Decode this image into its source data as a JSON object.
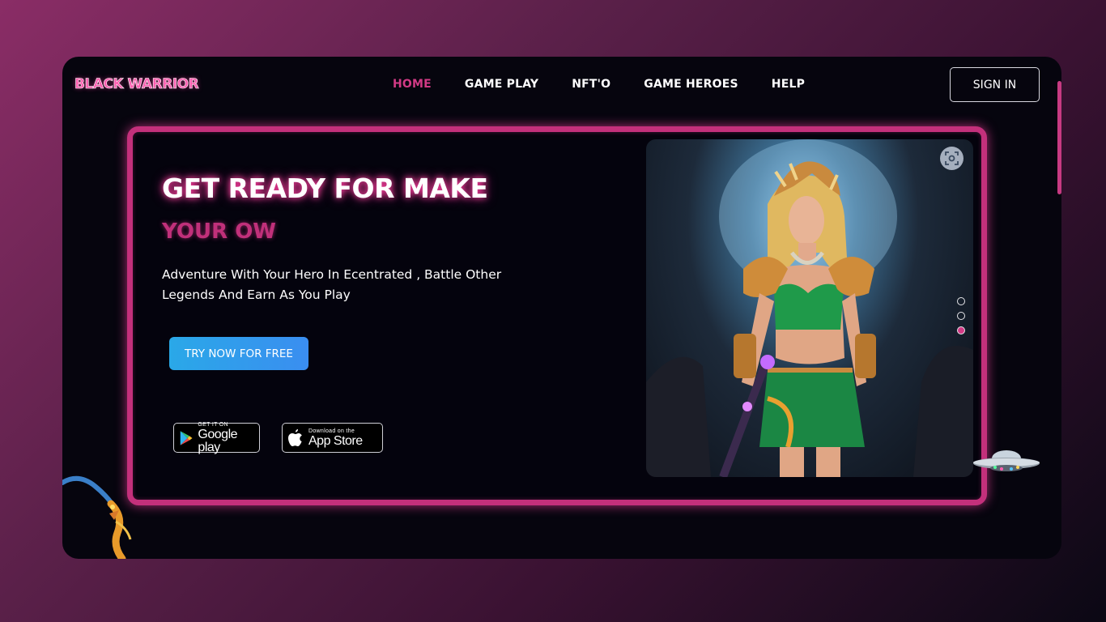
{
  "header": {
    "logo": "BLACK WARRIOR",
    "nav": [
      {
        "label": "HOME",
        "active": true
      },
      {
        "label": "GAME PLAY",
        "active": false
      },
      {
        "label": "NFT'O",
        "active": false
      },
      {
        "label": "GAME HEROES",
        "active": false
      },
      {
        "label": "HELP",
        "active": false
      }
    ],
    "signin_label": "SIGN IN"
  },
  "hero": {
    "headline": "GET READY FOR MAKE",
    "typed_text": "YOUR OW",
    "subtext": "Adventure With Your Hero In Ecentrated , Battle Other Legends And Earn As You Play",
    "cta_label": "TRY NOW FOR FREE",
    "google_play": {
      "small": "GET IT ON",
      "big": "Google play"
    },
    "app_store": {
      "small": "Download on the",
      "big": "App Store"
    }
  },
  "carousel": {
    "slide_count": 3,
    "active_index": 2
  },
  "colors": {
    "accent_pink": "#c3307b",
    "active_nav": "#d23a85",
    "cta_blue": "#2aa8e8",
    "page_bg": "#06050e"
  },
  "icons": [
    "zoom-icon",
    "google-play-icon",
    "apple-icon",
    "ufo-icon",
    "dragon-icon"
  ]
}
